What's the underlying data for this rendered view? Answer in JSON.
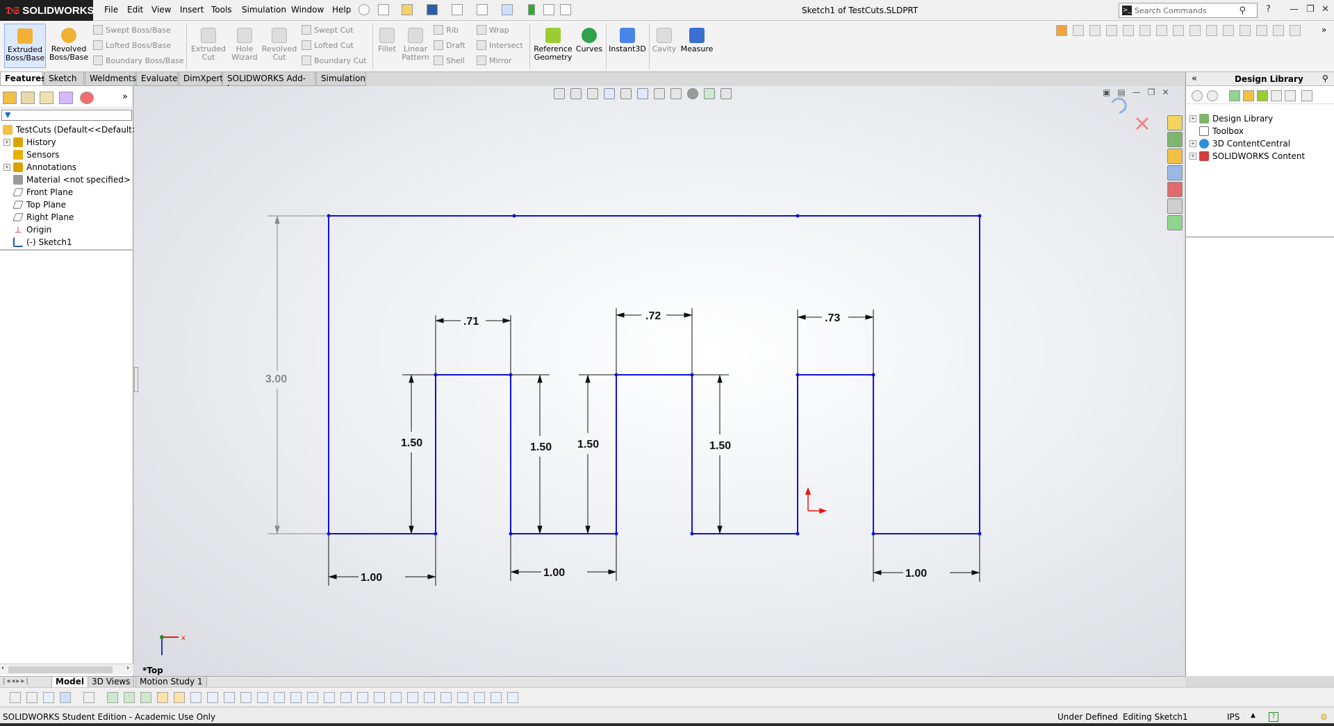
{
  "app": {
    "brand": "SOLIDWORKS",
    "window_title": "Sketch1 of TestCuts.SLDPRT"
  },
  "menu": [
    "File",
    "Edit",
    "View",
    "Insert",
    "Tools",
    "Simulation",
    "Window",
    "Help"
  ],
  "search": {
    "placeholder": "Search Commands"
  },
  "commands": {
    "extruded_boss": "Extruded Boss/Base",
    "revolved_boss": "Revolved Boss/Base",
    "swept_boss": "Swept Boss/Base",
    "lofted_boss": "Lofted Boss/Base",
    "boundary_boss": "Boundary Boss/Base",
    "extruded_cut": "Extruded Cut",
    "hole_wizard": "Hole Wizard",
    "revolved_cut": "Revolved Cut",
    "swept_cut": "Swept Cut",
    "lofted_cut": "Lofted Cut",
    "boundary_cut": "Boundary Cut",
    "fillet": "Fillet",
    "linear_pattern": "Linear Pattern",
    "rib": "Rib",
    "draft": "Draft",
    "shell": "Shell",
    "wrap": "Wrap",
    "intersect": "Intersect",
    "mirror": "Mirror",
    "reference_geometry": "Reference Geometry",
    "curves": "Curves",
    "instant3d": "Instant3D",
    "cavity": "Cavity",
    "measure": "Measure"
  },
  "tabs": [
    "Features",
    "Sketch",
    "Weldments",
    "Evaluate",
    "DimXpert",
    "SOLIDWORKS Add-Ins",
    "Simulation"
  ],
  "tree": {
    "root": "TestCuts  (Default<<Default>",
    "items": [
      {
        "label": "History",
        "expandable": true,
        "color": "#d9a400"
      },
      {
        "label": "Sensors",
        "expandable": false,
        "color": "#e7b000"
      },
      {
        "label": "Annotations",
        "expandable": true,
        "color": "#d9a400"
      },
      {
        "label": "Material <not specified>",
        "expandable": false,
        "color": "#7a7a7a"
      },
      {
        "label": "Front Plane",
        "expandable": false,
        "color": "#555555"
      },
      {
        "label": "Top Plane",
        "expandable": false,
        "color": "#555555"
      },
      {
        "label": "Right Plane",
        "expandable": false,
        "color": "#555555"
      },
      {
        "label": "Origin",
        "expandable": false,
        "color": "#aa2222"
      },
      {
        "label": "(-) Sketch1",
        "expandable": false,
        "color": "#2255aa"
      }
    ]
  },
  "sketch": {
    "dims": {
      "overall_height": "3.00",
      "slot1_width": ".71",
      "slot2_width": ".72",
      "slot3_width": ".73",
      "depth1": "1.50",
      "depth2": "1.50",
      "depth3": "1.50",
      "depth4": "1.50",
      "tooth1_width": "1.00",
      "tooth2_width": "1.00",
      "tooth3_width": "1.00"
    },
    "line_color": "#1010d8",
    "view_label": "*Top",
    "triad_x": "x"
  },
  "taskpane": {
    "title": "Design Library",
    "items": [
      "Design Library",
      "Toolbox",
      "3D ContentCentral",
      "SOLIDWORKS Content"
    ]
  },
  "bottom_tabs": [
    "Model",
    "3D Views",
    "Motion Study 1"
  ],
  "status": {
    "edition": "SOLIDWORKS Student Edition - Academic Use Only",
    "state": "Under Defined",
    "editing": "Editing Sketch1",
    "units": "IPS"
  }
}
